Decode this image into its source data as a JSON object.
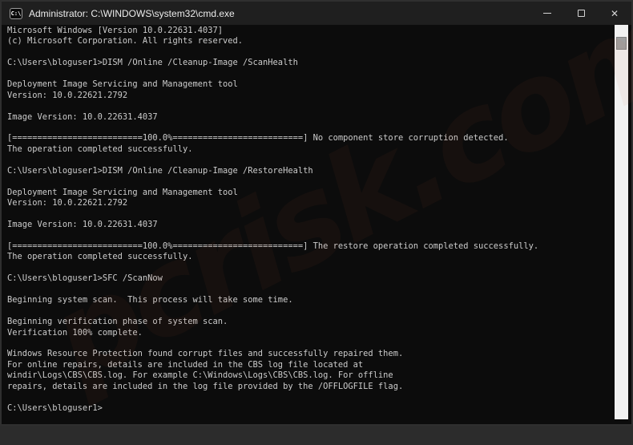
{
  "window": {
    "title": "Administrator: C:\\WINDOWS\\system32\\cmd.exe",
    "icon_glyph": "C:\\",
    "controls": {
      "close_glyph": "✕"
    }
  },
  "watermark": {
    "text": "pcrisk.com"
  },
  "scrollbar": {
    "thumb_position": "top"
  },
  "terminal": {
    "prompt": "C:\\Users\\bloguser1>",
    "lines": [
      "Microsoft Windows [Version 10.0.22631.4037]",
      "(c) Microsoft Corporation. All rights reserved.",
      "",
      "C:\\Users\\bloguser1>DISM /Online /Cleanup-Image /ScanHealth",
      "",
      "Deployment Image Servicing and Management tool",
      "Version: 10.0.22621.2792",
      "",
      "Image Version: 10.0.22631.4037",
      "",
      "[==========================100.0%==========================] No component store corruption detected.",
      "The operation completed successfully.",
      "",
      "C:\\Users\\bloguser1>DISM /Online /Cleanup-Image /RestoreHealth",
      "",
      "Deployment Image Servicing and Management tool",
      "Version: 10.0.22621.2792",
      "",
      "Image Version: 10.0.22631.4037",
      "",
      "[==========================100.0%==========================] The restore operation completed successfully.",
      "The operation completed successfully.",
      "",
      "C:\\Users\\bloguser1>SFC /ScanNow",
      "",
      "Beginning system scan.  This process will take some time.",
      "",
      "Beginning verification phase of system scan.",
      "Verification 100% complete.",
      "",
      "Windows Resource Protection found corrupt files and successfully repaired them.",
      "For online repairs, details are included in the CBS log file located at",
      "windir\\Logs\\CBS\\CBS.log. For example C:\\Windows\\Logs\\CBS\\CBS.log. For offline",
      "repairs, details are included in the log file provided by the /OFFLOGFILE flag.",
      "",
      "C:\\Users\\bloguser1>"
    ]
  },
  "colors": {
    "console_bg": "#0c0c0c",
    "console_text": "#cccccc",
    "titlebar_bg": "#1f1f1f",
    "scrollbar_track": "#f1f1f1",
    "scrollbar_thumb": "#9f9f9f"
  }
}
